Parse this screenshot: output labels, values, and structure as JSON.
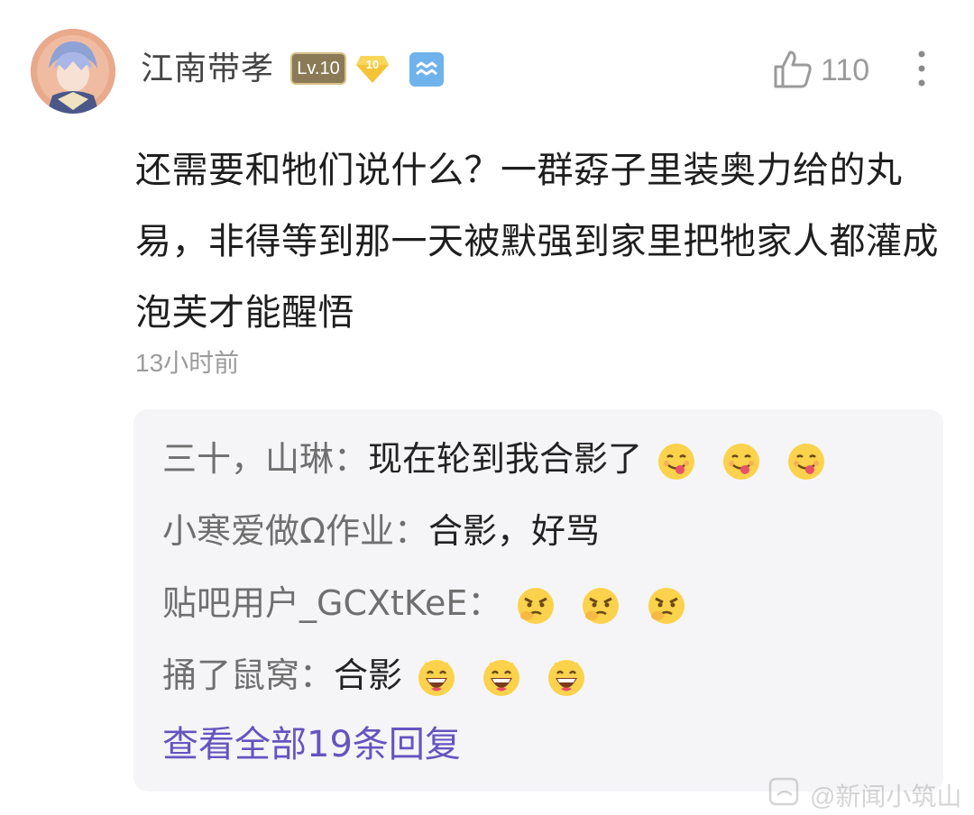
{
  "comment": {
    "username": "江南带孝",
    "level_badge": "Lv.10",
    "member_badge": "10",
    "like_count": "110",
    "text": "还需要和牠们说什么？一群孬子里装奥力给的丸易，非得等到那一天被默强到家里把牠家人都灌成泡芙才能醒悟",
    "time": "13小时前"
  },
  "replies": [
    {
      "name": "三十，山琳：",
      "content": "现在轮到我合影了",
      "emoji": "tongue-out-emoji"
    },
    {
      "name": "小寒爱做Ω作业：",
      "content": "合影，好骂",
      "emoji": ""
    },
    {
      "name": "贴吧用户_GCXtKeE：",
      "content": "",
      "emoji": "angry-thinking-emoji"
    },
    {
      "name": "捅了鼠窝：",
      "content": "合影",
      "emoji": "grinning-emoji"
    }
  ],
  "view_all_label": "查看全部19条回复",
  "watermark": "@新闻小筑山",
  "icons": {
    "like": "thumbs-up-icon",
    "more": "more-vertical-icon",
    "zodiac": "aquarius-icon"
  },
  "colors": {
    "link": "#6554c0",
    "reply_bg": "#f5f5f8",
    "reply_name": "#6f6f6f",
    "time": "#9c9c9c"
  }
}
